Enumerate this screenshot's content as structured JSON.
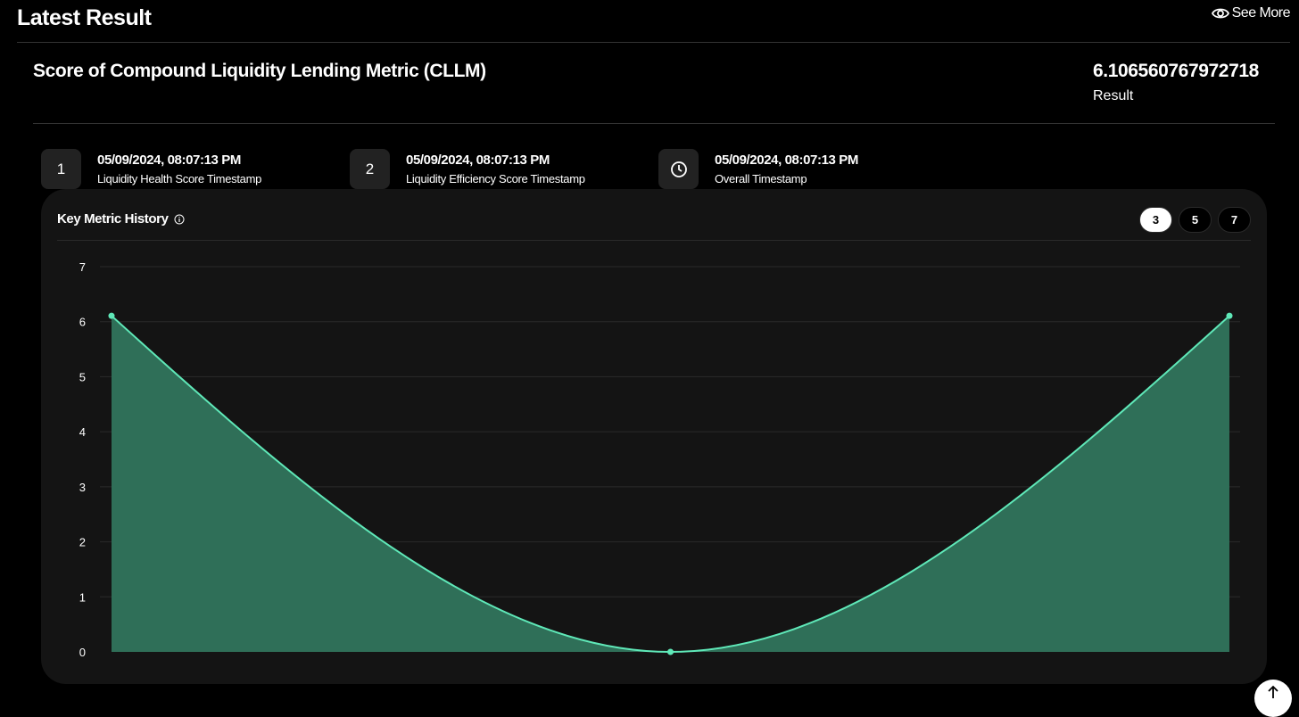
{
  "header": {
    "title": "Latest Result",
    "see_more": "See More"
  },
  "metric": {
    "name": "Score of Compound Liquidity Lending Metric (CLLM)",
    "value": "6.106560767972718",
    "value_label": "Result"
  },
  "timestamps": [
    {
      "badge": "1",
      "date": "05/09/2024, 08:07:13 PM",
      "label": "Liquidity Health Score Timestamp"
    },
    {
      "badge": "2",
      "date": "05/09/2024, 08:07:13 PM",
      "label": "Liquidity Efficiency Score Timestamp"
    },
    {
      "badge": "clock-icon",
      "date": "05/09/2024, 08:07:13 PM",
      "label": "Overall Timestamp"
    }
  ],
  "history": {
    "title": "Key Metric History",
    "ranges": [
      "3",
      "5",
      "7"
    ],
    "selected": "3"
  },
  "colors": {
    "line": "#5fe8b8",
    "fill": "#2f6f58",
    "card": "#141414"
  },
  "chart_data": {
    "type": "area",
    "title": "Key Metric History",
    "x": [
      0,
      1,
      2
    ],
    "values": [
      6.106560767972718,
      0,
      6.106560767972718
    ],
    "ylim": [
      0,
      7
    ],
    "yticks": [
      "0",
      "1",
      "2",
      "3",
      "4",
      "5",
      "6",
      "7"
    ],
    "grid": true,
    "xlabel": "",
    "ylabel": ""
  }
}
